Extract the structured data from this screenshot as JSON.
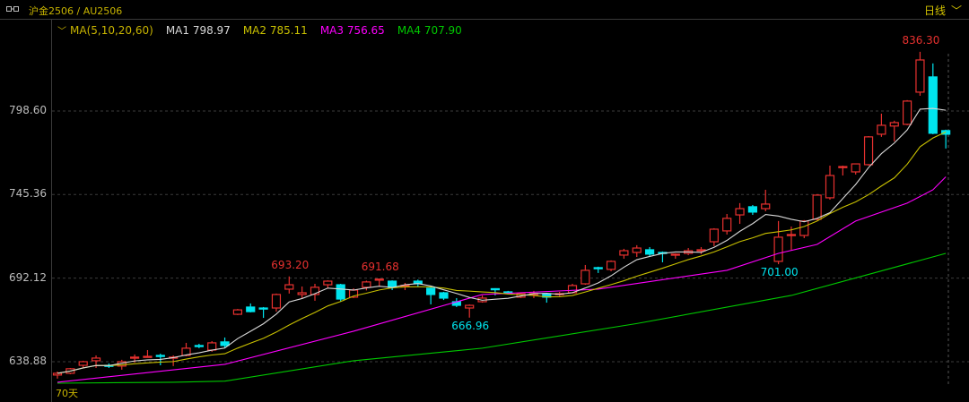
{
  "header": {
    "title": "沪金2506 / AU2506",
    "period": "日线",
    "period_chevron": "chevron-down-icon",
    "link_icon": "link-icon"
  },
  "legend": {
    "name": "MA(5,10,20,60)",
    "ma1": "MA1 798.97",
    "ma2": "MA2 785.11",
    "ma3": "MA3 756.65",
    "ma4": "MA4 707.90"
  },
  "footer": {
    "days": "70天"
  },
  "colors": {
    "up": "#e8312f",
    "down": "#00e4ee",
    "ma1": "#d8d8d8",
    "ma2": "#c8c000",
    "ma3": "#ff00ff",
    "ma4": "#00c800",
    "legend_name": "#c8b400"
  },
  "chart_data": {
    "type": "candlestick",
    "title": "沪金2506 / AU2506",
    "ylim": [
      615.5,
      844.2
    ],
    "yticks": [
      {
        "value": 798.6,
        "label": "798.60"
      },
      {
        "value": 745.36,
        "label": "745.36"
      },
      {
        "value": 692.12,
        "label": "692.12"
      },
      {
        "value": 638.88,
        "label": "638.88"
      }
    ],
    "grid": true,
    "ohlc": [
      [
        630.4,
        632.6,
        628.1,
        631.5
      ],
      [
        631.5,
        634.9,
        630.9,
        634.4
      ],
      [
        636.6,
        639.5,
        634.9,
        638.9
      ],
      [
        639.5,
        642.9,
        634.9,
        641.2
      ],
      [
        636.6,
        637.8,
        634.9,
        636.1
      ],
      [
        636.1,
        640.1,
        633.8,
        638.9
      ],
      [
        641.5,
        643.5,
        638.3,
        641.8
      ],
      [
        642.1,
        646.3,
        641.8,
        642.3
      ],
      [
        642.9,
        644.0,
        636.6,
        642.6
      ],
      [
        641.5,
        642.9,
        636.1,
        641.8
      ],
      [
        642.9,
        650.9,
        642.3,
        647.5
      ],
      [
        649.2,
        650.3,
        647.5,
        648.6
      ],
      [
        646.3,
        652.0,
        645.2,
        650.9
      ],
      [
        651.5,
        654.3,
        647.5,
        649.2
      ],
      [
        669.1,
        672.5,
        668.6,
        671.9
      ],
      [
        673.7,
        676.0,
        670.3,
        670.8
      ],
      [
        673.1,
        673.7,
        666.8,
        672.5
      ],
      [
        673.1,
        682.3,
        670.8,
        681.7
      ],
      [
        685.1,
        693.2,
        682.3,
        687.9
      ],
      [
        681.7,
        686.8,
        679.4,
        682.8
      ],
      [
        681.7,
        688.5,
        677.7,
        686.3
      ],
      [
        687.9,
        690.7,
        685.7,
        690.2
      ],
      [
        687.9,
        688.5,
        677.1,
        678.8
      ],
      [
        680.0,
        685.7,
        679.4,
        684.5
      ],
      [
        686.3,
        690.5,
        684.3,
        689.7
      ],
      [
        691.2,
        691.68,
        686.8,
        691.5
      ],
      [
        690.2,
        690.7,
        684.5,
        686.3
      ],
      [
        687.2,
        689.1,
        684.5,
        687.5
      ],
      [
        690.2,
        691.2,
        686.5,
        688.5
      ],
      [
        685.7,
        686.3,
        675.4,
        681.7
      ],
      [
        682.8,
        683.4,
        678.2,
        679.4
      ],
      [
        677.1,
        679.4,
        673.7,
        674.8
      ],
      [
        673.1,
        675.4,
        666.96,
        674.8
      ],
      [
        677.1,
        681.1,
        676.5,
        679.4
      ],
      [
        685.4,
        685.7,
        681.1,
        685.1
      ],
      [
        683.4,
        684.0,
        681.7,
        682.3
      ],
      [
        680.0,
        682.8,
        679.4,
        682.3
      ],
      [
        682.0,
        684.0,
        679.4,
        682.3
      ],
      [
        682.3,
        682.8,
        676.5,
        680.0
      ],
      [
        682.0,
        683.4,
        680.6,
        682.3
      ],
      [
        682.8,
        688.5,
        682.3,
        687.4
      ],
      [
        688.5,
        700.5,
        687.9,
        697.1
      ],
      [
        698.8,
        699.4,
        695.4,
        698.5
      ],
      [
        697.7,
        703.4,
        696.5,
        702.8
      ],
      [
        706.8,
        710.8,
        704.5,
        709.6
      ],
      [
        708.5,
        713.1,
        705.6,
        711.3
      ],
      [
        710.2,
        711.9,
        706.2,
        707.4
      ],
      [
        708.5,
        709.1,
        702.2,
        708.2
      ],
      [
        707.1,
        707.9,
        704.5,
        707.4
      ],
      [
        707.9,
        711.3,
        706.8,
        709.6
      ],
      [
        709.9,
        711.9,
        707.4,
        710.2
      ],
      [
        715.3,
        723.9,
        712.5,
        723.3
      ],
      [
        722.2,
        733.0,
        719.9,
        730.2
      ],
      [
        732.4,
        739.9,
        726.7,
        736.4
      ],
      [
        737.6,
        738.7,
        732.4,
        734.2
      ],
      [
        736.4,
        748.4,
        734.7,
        739.3
      ],
      [
        702.8,
        728.5,
        701.0,
        718.2
      ],
      [
        719.6,
        725.0,
        710.2,
        719.9
      ],
      [
        719.3,
        729.1,
        717.6,
        728.5
      ],
      [
        729.6,
        745.6,
        729.1,
        745.0
      ],
      [
        743.3,
        763.8,
        742.1,
        757.5
      ],
      [
        763.0,
        763.8,
        757.5,
        763.2
      ],
      [
        759.8,
        764.9,
        758.1,
        764.9
      ],
      [
        764.4,
        782.6,
        763.8,
        782.1
      ],
      [
        783.8,
        796.9,
        782.1,
        789.5
      ],
      [
        789.0,
        792.4,
        779.2,
        791.2
      ],
      [
        790.1,
        805.5,
        789.5,
        804.9
      ],
      [
        810.6,
        836.3,
        808.3,
        831.1
      ],
      [
        820.3,
        828.9,
        783.8,
        784.4
      ],
      [
        786.1,
        786.7,
        774.7,
        783.8
      ]
    ],
    "ma_periods": [
      5,
      10,
      20,
      60
    ],
    "ma3_points": [
      [
        0,
        625.8
      ],
      [
        13,
        637.2
      ],
      [
        23,
        658.3
      ],
      [
        33,
        681.7
      ],
      [
        42,
        685.1
      ],
      [
        52,
        697.1
      ],
      [
        56,
        707.9
      ],
      [
        59,
        713.6
      ],
      [
        62,
        728.5
      ],
      [
        66,
        739.9
      ],
      [
        68,
        748.4
      ],
      [
        69,
        756.65
      ]
    ],
    "ma4_points": [
      [
        0,
        625.2
      ],
      [
        9,
        625.8
      ],
      [
        13,
        626.5
      ],
      [
        23,
        639.5
      ],
      [
        33,
        647.5
      ],
      [
        45,
        663.2
      ],
      [
        57,
        681.1
      ],
      [
        69,
        707.9
      ]
    ],
    "annotations": [
      {
        "index": 18,
        "label": "693.20",
        "position": "above",
        "kind": "up"
      },
      {
        "index": 25,
        "label": "691.68",
        "position": "above",
        "kind": "up"
      },
      {
        "index": 32,
        "label": "666.96",
        "position": "below",
        "kind": "down"
      },
      {
        "index": 56,
        "label": "701.00",
        "position": "below",
        "kind": "down"
      },
      {
        "index": 67,
        "label": "836.30",
        "position": "above",
        "kind": "up"
      }
    ]
  }
}
